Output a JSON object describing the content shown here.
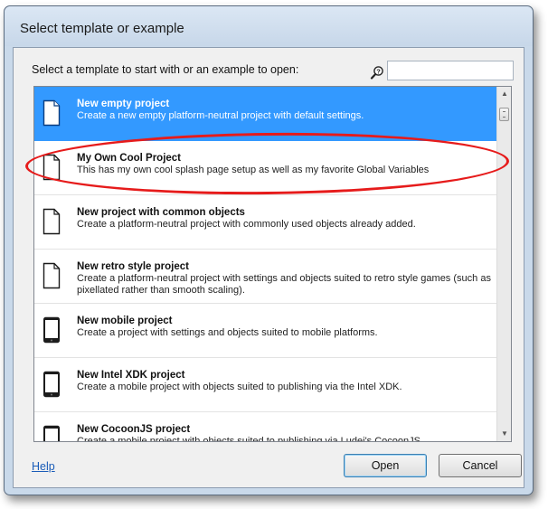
{
  "window": {
    "title": "Select template or example"
  },
  "dialog": {
    "prompt": "Select a template to start with or an example to open:",
    "search": {
      "value": "",
      "placeholder": ""
    }
  },
  "items": [
    {
      "name": "New empty project",
      "description": "Create a new empty platform-neutral project with default settings.",
      "icon": "document-icon",
      "selected": true
    },
    {
      "name": "My Own Cool Project",
      "description": "This has my own cool splash page setup as well as my favorite Global Variables",
      "icon": "document-icon",
      "selected": false
    },
    {
      "name": "New project with common objects",
      "description": "Create a platform-neutral project with commonly used objects already added.",
      "icon": "document-icon",
      "selected": false
    },
    {
      "name": "New retro style project",
      "description": "Create a platform-neutral project with settings and objects suited to retro style games (such as pixellated rather than smooth scaling).",
      "icon": "document-icon",
      "selected": false
    },
    {
      "name": "New mobile project",
      "description": "Create a project with settings and objects suited to mobile platforms.",
      "icon": "phone-icon",
      "selected": false
    },
    {
      "name": "New Intel XDK project",
      "description": "Create a mobile project with objects suited to publishing via the Intel XDK.",
      "icon": "phone-icon",
      "selected": false
    },
    {
      "name": "New CocoonJS project",
      "description": "Create a mobile project with objects suited to publishing via Ludei's CocoonJS.",
      "icon": "phone-icon",
      "selected": false
    }
  ],
  "footer": {
    "help_label": "Help",
    "open_label": "Open",
    "cancel_label": "Cancel"
  },
  "colors": {
    "selection": "#3399ff",
    "highlight_circle": "#e61b1b",
    "link": "#1a5cb8"
  }
}
